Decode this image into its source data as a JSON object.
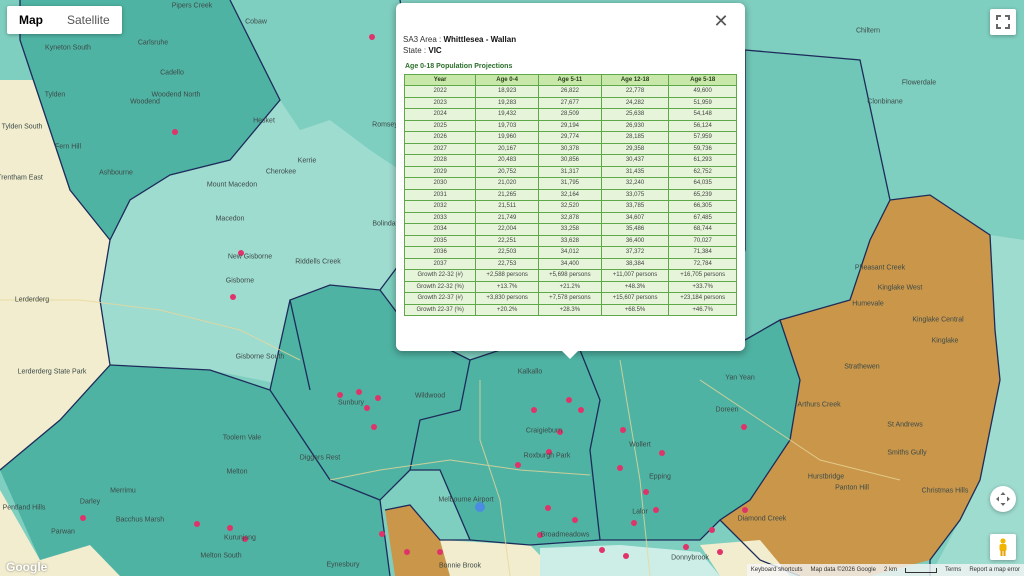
{
  "map_type": {
    "map_label": "Map",
    "satellite_label": "Satellite"
  },
  "popup": {
    "area_label": "SA3 Area :",
    "area_value": "Whittlesea - Wallan",
    "state_label": "State :",
    "state_value": "VIC",
    "table_title": "Age 0-18 Population Projections",
    "columns": [
      "Year",
      "Age 0-4",
      "Age 5-11",
      "Age 12-18",
      "Age 5-18"
    ],
    "rows": [
      [
        "2022",
        "18,923",
        "26,822",
        "22,778",
        "49,600"
      ],
      [
        "2023",
        "19,283",
        "27,677",
        "24,282",
        "51,959"
      ],
      [
        "2024",
        "19,432",
        "28,509",
        "25,638",
        "54,148"
      ],
      [
        "2025",
        "19,703",
        "29,194",
        "26,930",
        "56,124"
      ],
      [
        "2026",
        "19,960",
        "29,774",
        "28,185",
        "57,959"
      ],
      [
        "2027",
        "20,167",
        "30,378",
        "29,358",
        "59,736"
      ],
      [
        "2028",
        "20,483",
        "30,856",
        "30,437",
        "61,293"
      ],
      [
        "2029",
        "20,752",
        "31,317",
        "31,435",
        "62,752"
      ],
      [
        "2030",
        "21,020",
        "31,795",
        "32,240",
        "64,035"
      ],
      [
        "2031",
        "21,265",
        "32,164",
        "33,075",
        "65,239"
      ],
      [
        "2032",
        "21,511",
        "32,520",
        "33,785",
        "66,305"
      ],
      [
        "2033",
        "21,749",
        "32,878",
        "34,607",
        "67,485"
      ],
      [
        "2034",
        "22,004",
        "33,258",
        "35,486",
        "68,744"
      ],
      [
        "2035",
        "22,251",
        "33,628",
        "36,400",
        "70,027"
      ],
      [
        "2036",
        "22,503",
        "34,012",
        "37,372",
        "71,384"
      ],
      [
        "2037",
        "22,753",
        "34,400",
        "38,384",
        "72,784"
      ],
      [
        "Growth 22-32 (#)",
        "+2,588 persons",
        "+5,698 persons",
        "+11,007 persons",
        "+16,705 persons"
      ],
      [
        "Growth 22-32 (%)",
        "+13.7%",
        "+21.2%",
        "+48.3%",
        "+33.7%"
      ],
      [
        "Growth 22-37 (#)",
        "+3,830 persons",
        "+7,578 persons",
        "+15,607 persons",
        "+23,184 persons"
      ],
      [
        "Growth 22-37 (%)",
        "+20.2%",
        "+28.3%",
        "+68.5%",
        "+46.7%"
      ]
    ]
  },
  "map_labels": [
    "Pipers Creek",
    "Cobaw",
    "Kyneton South",
    "Carlsruhe",
    "Cadello",
    "Woodend North",
    "Woodend",
    "Tylden",
    "Tylden South",
    "Fern Hill",
    "Trentham East",
    "Ashbourne",
    "Hesket",
    "Romsey",
    "Mount Macedon",
    "Cherokee",
    "Kerrie",
    "Bolinda",
    "Macedon",
    "New Gisborne",
    "Riddells Creek",
    "Gisborne",
    "Gisborne South",
    "Lerderderg",
    "Lerderderg State Park",
    "Wildwood",
    "Sunbury",
    "Diggers Rest",
    "Toolern Vale",
    "Melton",
    "Merrimu",
    "Darley",
    "Bacchus Marsh",
    "Parwan",
    "Pentland Hills",
    "Kurunjang",
    "Melton South",
    "Eynesbury",
    "Bonnie Brook",
    "Roxburgh Park",
    "Craigieburn",
    "Broadmeadows",
    "Melbourne Airport",
    "Epping",
    "Lalor",
    "Doreen",
    "Yan Yean",
    "Arthurs Creek",
    "Strathewen",
    "St Andrews",
    "Smiths Gully",
    "Hurstbridge",
    "Panton Hill",
    "Christmas Hills",
    "Diamond Creek",
    "Kinglake",
    "Kinglake Central",
    "Kinglake West",
    "Pheasant Creek",
    "Clonbinane",
    "Humevale",
    "Flowerdale",
    "Chiltern",
    "Donnybrook",
    "Wollert",
    "Kalkallo"
  ],
  "controls": {
    "fullscreen_icon": "fullscreen-icon",
    "move_icon": "move-icon",
    "pegman_icon": "pegman-icon",
    "close_icon": "close-icon"
  },
  "footer": {
    "shortcuts": "Keyboard shortcuts",
    "mapdata": "Map data ©2026 Google",
    "scale": "2 km",
    "terms": "Terms",
    "report": "Report a map error"
  },
  "logo": "Google",
  "colors": {
    "dark_region": "#4fb3a3",
    "mid_region": "#70c7b8",
    "light_region": "#9fdcd0",
    "orange_region": "#c9964a",
    "cream_region": "#f2edcf",
    "boundary": "#1d2b5a",
    "marker": "#e0336a",
    "table_header": "#c7e8a8",
    "table_cell": "#e6f5d9"
  }
}
